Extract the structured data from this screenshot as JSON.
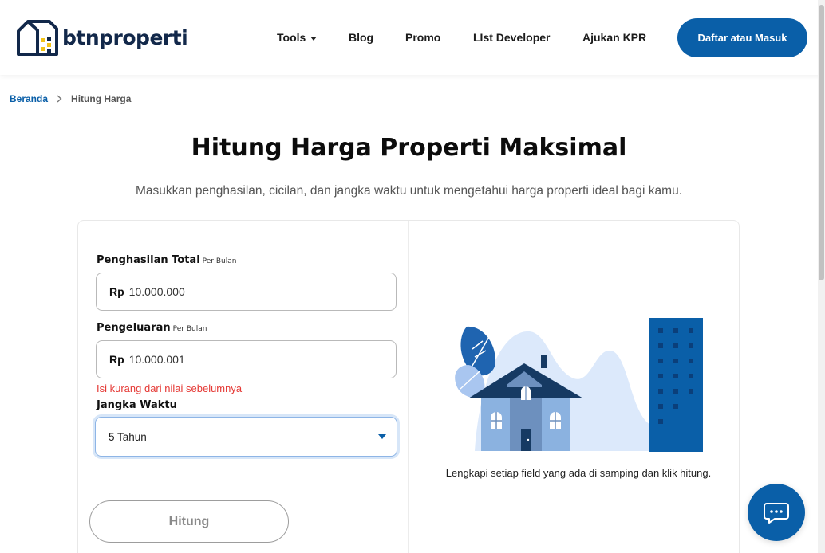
{
  "brand": {
    "name": "btnproperti"
  },
  "nav": {
    "items": [
      {
        "label": "Tools",
        "has_dropdown": true
      },
      {
        "label": "Blog"
      },
      {
        "label": "Promo"
      },
      {
        "label": "LIst Developer"
      },
      {
        "label": "Ajukan KPR"
      }
    ],
    "login_label": "Daftar atau Masuk"
  },
  "breadcrumb": {
    "home": "Beranda",
    "current": "Hitung Harga"
  },
  "page": {
    "title": "Hitung Harga Properti Maksimal",
    "subtitle": "Masukkan penghasilan, cicilan, dan jangka waktu untuk mengetahui harga properti ideal bagi kamu."
  },
  "form": {
    "income": {
      "label": "Penghasilan Total",
      "suffix": "Per Bulan",
      "currency": "Rp",
      "value": "10.000.000"
    },
    "expense": {
      "label": "Pengeluaran",
      "suffix": "Per Bulan",
      "currency": "Rp",
      "value": "10.000.001",
      "error": "Isi kurang dari nilai sebelumnya"
    },
    "term": {
      "label": "Jangka Waktu",
      "selected": "5 Tahun"
    },
    "submit_label": "Hitung"
  },
  "result": {
    "hint": "Lengkapi setiap field yang ada di samping dan klik hitung."
  },
  "colors": {
    "brand_blue": "#0a5fa8",
    "navy": "#12284a",
    "error": "#e53935"
  },
  "icons": {
    "chat": "chat-bubble-icon",
    "breadcrumb_sep": "chevron-right-icon",
    "dropdown": "caret-down-icon"
  }
}
